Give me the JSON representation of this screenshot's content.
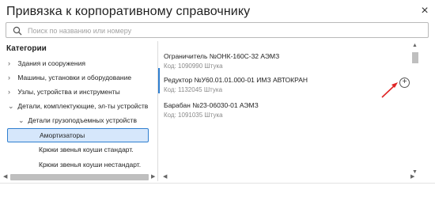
{
  "dialog": {
    "title": "Привязка к корпоративному справочнику",
    "close_glyph": "×"
  },
  "search": {
    "placeholder": "Поиск по названию или номеру",
    "value": ""
  },
  "categories": {
    "heading": "Категории",
    "items": [
      {
        "label": "Здания и сооружения",
        "expanded": false
      },
      {
        "label": "Машины, установки и оборудование",
        "expanded": false
      },
      {
        "label": "Узлы, устройства и инструменты",
        "expanded": false
      },
      {
        "label": "Детали, комплектующие, эл-ты устройств",
        "expanded": true
      },
      {
        "label": "Детали грузоподъемных устройств",
        "expanded": true
      },
      {
        "label": "Амортизаторы",
        "selected": true
      },
      {
        "label": "Крюки звенья коуши стандарт."
      },
      {
        "label": "Крюки звенья коуши нестандарт."
      }
    ]
  },
  "results": [
    {
      "name": "Ограничитель №ОНК-160С-32 АЭМЗ",
      "code": "Код: 1090990 Штука"
    },
    {
      "name": "Редуктор №У60.01.01.000-01 ИМЗ АВТОКРАН",
      "code": "Код: 1132045 Штука"
    },
    {
      "name": "Барабан №23-06030-01 АЭМЗ",
      "code": "Код: 1091035 Штука"
    }
  ],
  "colors": {
    "accent": "#2f7fd0",
    "selection_bg": "#d6e7fb",
    "annotation_arrow": "#e02424"
  },
  "icons": {
    "search": "search-icon",
    "close": "close-icon",
    "add": "plus-circle-icon",
    "chevron_right": "chevron-right-icon",
    "chevron_down": "chevron-down-icon"
  }
}
